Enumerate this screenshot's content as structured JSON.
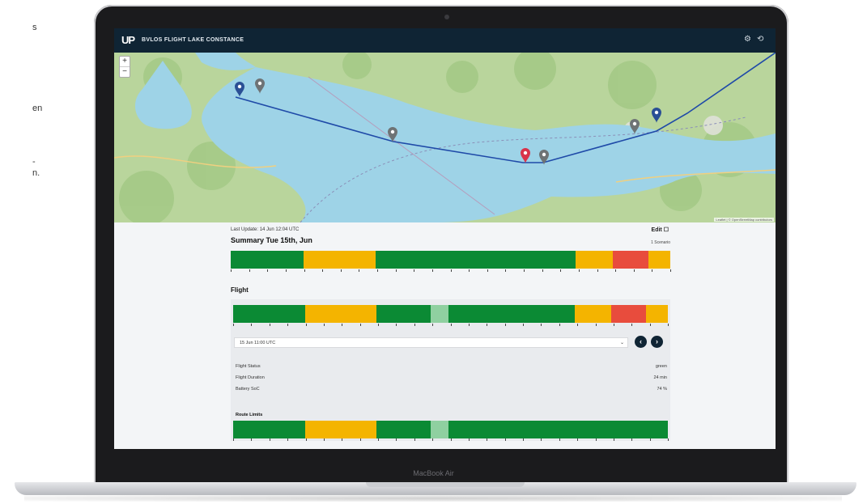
{
  "side_text": [
    "s",
    "en",
    "-",
    "n."
  ],
  "device": {
    "label": "MacBook Air"
  },
  "header": {
    "logo": "UP",
    "title": "BVLOS FLIGHT LAKE CONSTANCE",
    "settings_icon": "gear-icon",
    "logout_icon": "logout-icon"
  },
  "map": {
    "zoom_in": "+",
    "zoom_out": "−",
    "attribution": "Leaflet | © OpenStreetMap contributors"
  },
  "content": {
    "last_update": "Last Update: 14 Jun 12:04 UTC",
    "edit_label": "Edit ☐",
    "summary_title": "Summary Tue 15th, Jun",
    "summary_note": "1 Scenario",
    "flight_title": "Flight",
    "time_select": "15 Jun 11:00 UTC",
    "stats": [
      {
        "label": "Flight Status",
        "value": "green"
      },
      {
        "label": "Flight Duration",
        "value": "24 min"
      },
      {
        "label": "Battery SoC",
        "value": "74 %"
      }
    ],
    "route_title": "Route Limits"
  },
  "colors": {
    "green": "#0b8a34",
    "yellow": "#f4b400",
    "red": "#e84c3d",
    "lightgreen": "#8fd0a0",
    "header": "#0f2434"
  },
  "bars": {
    "summary": [
      [
        "green",
        0.165
      ],
      [
        "yellow",
        0.165
      ],
      [
        "green",
        0.455
      ],
      [
        "yellow",
        0.085
      ],
      [
        "red",
        0.08
      ],
      [
        "yellow",
        0.05
      ]
    ],
    "flight": [
      [
        "green",
        0.165
      ],
      [
        "yellow",
        0.165
      ],
      [
        "green",
        0.125
      ],
      [
        "lightgreen",
        0.04
      ],
      [
        "green",
        0.29
      ],
      [
        "yellow",
        0.085
      ],
      [
        "red",
        0.08
      ],
      [
        "yellow",
        0.05
      ]
    ],
    "route": [
      [
        "green",
        0.165
      ],
      [
        "yellow",
        0.165
      ],
      [
        "green",
        0.125
      ],
      [
        "lightgreen",
        0.04
      ],
      [
        "green",
        0.505
      ]
    ]
  }
}
